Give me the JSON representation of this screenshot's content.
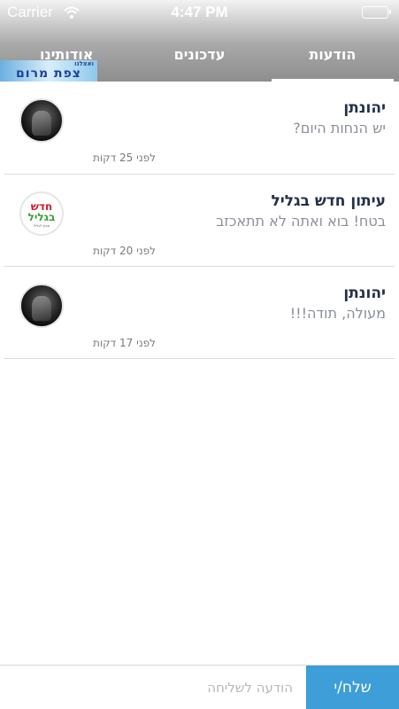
{
  "status_bar": {
    "carrier": "Carrier",
    "time": "4:47 PM"
  },
  "tabs": [
    {
      "label": "הודעות",
      "active": true
    },
    {
      "label": "עדכונים",
      "active": false
    },
    {
      "label": "אודותינו",
      "active": false
    }
  ],
  "header_logo": {
    "top_text": "ואצלנו",
    "main_text": "צפת מרום"
  },
  "messages": [
    {
      "sender": "יהונתן",
      "text": "יש הנחות היום?",
      "time": "לפני 25 דקות",
      "avatar": "dark-photo-avatar"
    },
    {
      "sender": "עיתון חדש בגליל",
      "text": "בטח! בוא ואתה לא תתאכזב",
      "time": "לפני 20 דקות",
      "avatar": "newspaper-logo-avatar",
      "avatar_logo": {
        "line1": "חדש",
        "line2": "בגליל",
        "line3": "מגזין לגליל"
      }
    },
    {
      "sender": "יהונתן",
      "text": "מעולה, תודה!!!",
      "time": "לפני 17 דקות",
      "avatar": "dark-photo-avatar"
    }
  ],
  "compose": {
    "placeholder": "הודעה לשליחה",
    "value": "",
    "send_label": "שלח/י"
  },
  "colors": {
    "send_button": "#3d9ed8",
    "sender_text": "#23304a",
    "message_text": "#8a8f99"
  }
}
